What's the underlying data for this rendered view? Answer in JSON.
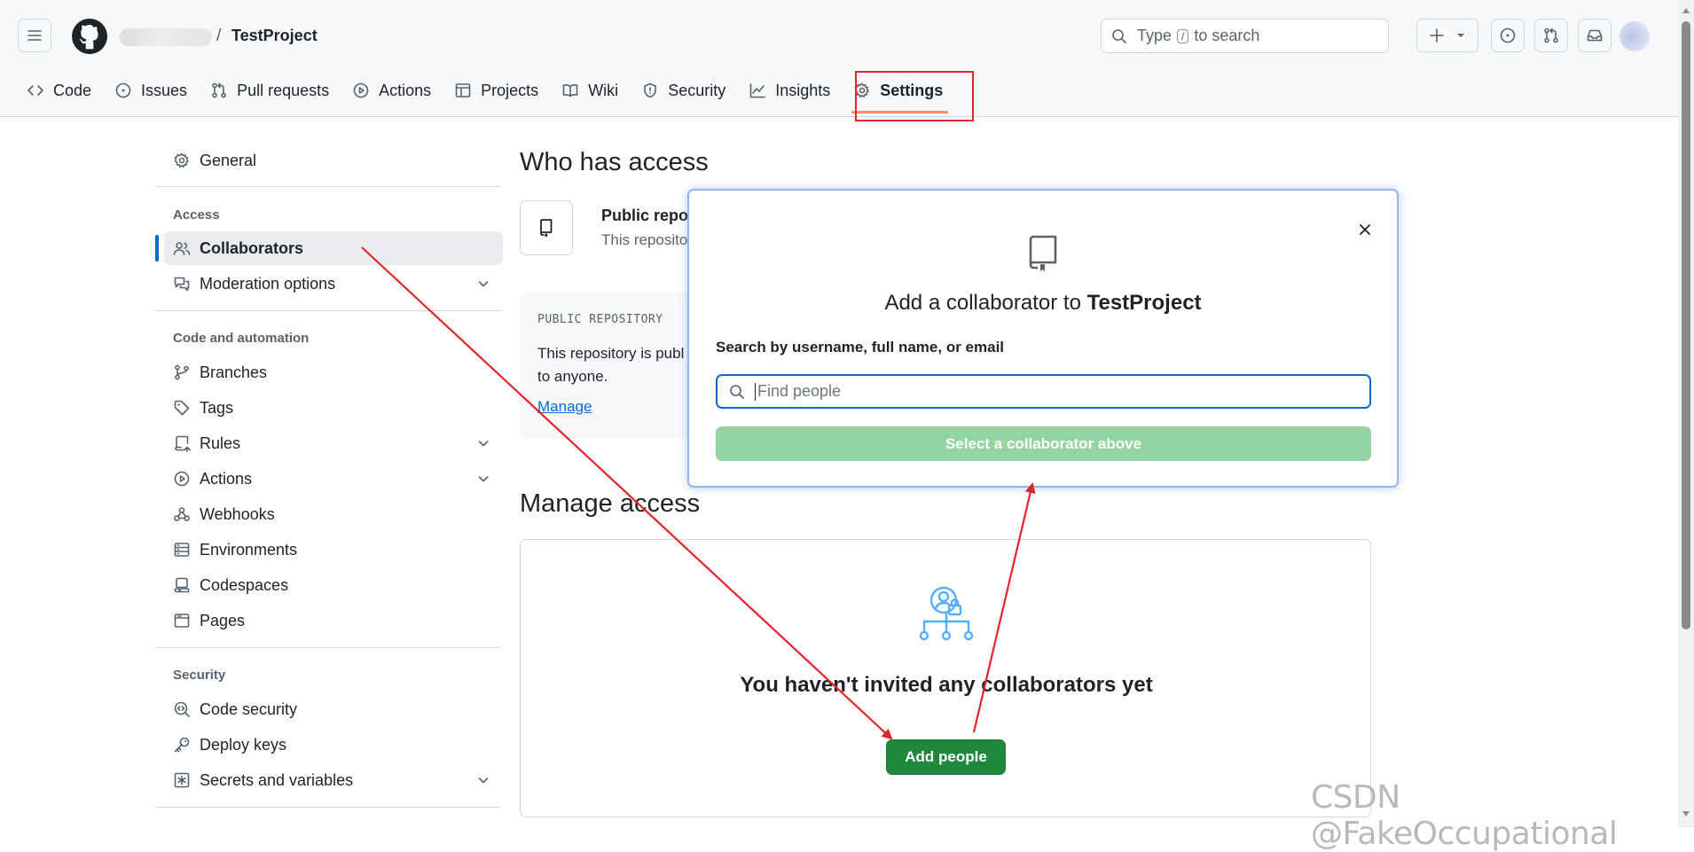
{
  "header": {
    "repo_name": "TestProject",
    "separator": "/",
    "search": {
      "prefix": "Type",
      "key": "/",
      "suffix": "to search"
    }
  },
  "repo_tabs": [
    {
      "label": "Code",
      "icon": "code-icon"
    },
    {
      "label": "Issues",
      "icon": "issue-icon"
    },
    {
      "label": "Pull requests",
      "icon": "pull-request-icon"
    },
    {
      "label": "Actions",
      "icon": "play-icon"
    },
    {
      "label": "Projects",
      "icon": "table-icon"
    },
    {
      "label": "Wiki",
      "icon": "book-icon"
    },
    {
      "label": "Security",
      "icon": "shield-icon"
    },
    {
      "label": "Insights",
      "icon": "graph-icon"
    },
    {
      "label": "Settings",
      "icon": "gear-icon",
      "selected": true
    }
  ],
  "sidebar": {
    "general": "General",
    "access_heading": "Access",
    "collaborators": "Collaborators",
    "moderation": "Moderation options",
    "code_heading": "Code and automation",
    "branches": "Branches",
    "tags": "Tags",
    "rules": "Rules",
    "actions": "Actions",
    "webhooks": "Webhooks",
    "environments": "Environments",
    "codespaces": "Codespaces",
    "pages": "Pages",
    "security_heading": "Security",
    "code_security": "Code security",
    "deploy_keys": "Deploy keys",
    "secrets": "Secrets and variables"
  },
  "main": {
    "who_has_access": "Who has access",
    "visibility_title": "Public repo",
    "visibility_desc": "This reposito",
    "public_label": "PUBLIC REPOSITORY",
    "public_desc": "This repository is publ to anyone.",
    "manage_link": "Manage",
    "manage_access": "Manage access",
    "empty_title": "You haven't invited any collaborators yet",
    "add_people": "Add people"
  },
  "dialog": {
    "title_prefix": "Add a collaborator to",
    "title_repo": "TestProject",
    "search_label": "Search by username, full name, or email",
    "search_placeholder": "Find people",
    "submit": "Select a collaborator above"
  },
  "colors": {
    "accent_blue": "#0969da",
    "primary_green": "#1f883d",
    "disabled_green": "#94d3a2",
    "annotation_red": "#e5232a",
    "tab_underline": "#fd8c73"
  },
  "watermark": "CSDN @FakeOccupational"
}
